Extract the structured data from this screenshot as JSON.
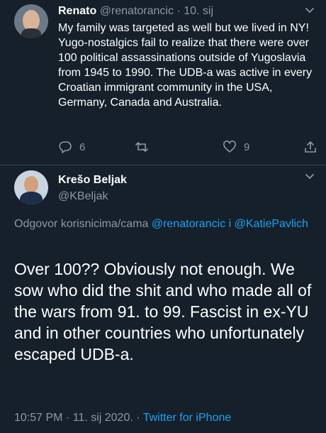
{
  "tweet1": {
    "name": "Renato",
    "handle": "@renatorancic",
    "sep": "·",
    "date": "10. sij",
    "text": "My family was targeted as well but we lived in NY! Yugo-nostalgics fail to realize that there were over 100 political assassinations outside of Yugoslavia from 1945 to 1990. The UDB-a was active in every Croatian immigrant community in the USA, Germany, Canada and Australia.",
    "reply_count": "6",
    "like_count": "9"
  },
  "tweet2": {
    "name": "Krešo Beljak",
    "handle": "@KBeljak",
    "replying_prefix": "Odgovor korisnicima/cama",
    "reply_to_1": "@renatorancic",
    "reply_conj": "i",
    "reply_to_2": "@KatiePavlich",
    "text": "Over 100?? Obviously not enough. We sow who did the shit and who made all of the wars from 91. to 99. Fascist in ex-YU and in other countries who unfortunately escaped UDB-a.",
    "timestamp": "10:57 PM · 11. sij 2020.",
    "meta_sep": "·",
    "source": "Twitter for iPhone"
  },
  "colors": {
    "background": "#15202b",
    "secondary_text": "#8899a6",
    "link": "#1da1f2",
    "divider": "#38444d"
  }
}
